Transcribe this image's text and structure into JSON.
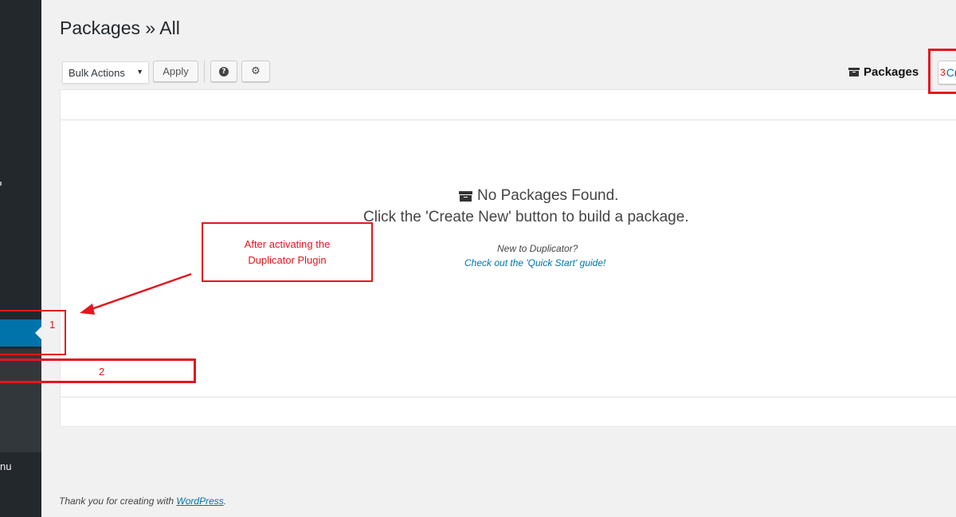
{
  "page": {
    "title": "Packages » All"
  },
  "toolbar": {
    "bulk_actions_label": "Bulk Actions",
    "apply_label": "Apply",
    "help_icon": "question-circle-icon",
    "settings_icon": "gear-icon",
    "packages_tab_label": "Packages",
    "create_new_visible_label": "Cr"
  },
  "empty_state": {
    "title": "No Packages Found.",
    "subtitle": "Click the 'Create New' button to build a package.",
    "new_to_text": "New to Duplicator?",
    "quick_start_link": "Check out the 'Quick Start' guide!"
  },
  "sidebar": {
    "collapse_label_fragment": "nu"
  },
  "footer": {
    "prefix": "Thank you for creating with ",
    "link": "WordPress",
    "suffix": "."
  },
  "annotations": {
    "callout_line1": "After activating the",
    "callout_line2": "Duplicator Plugin",
    "marker_1": "1",
    "marker_2": "2",
    "marker_3": "3"
  },
  "colors": {
    "sidebar_bg": "#23282d",
    "sidebar_submenu_bg": "#32373c",
    "sidebar_current": "#0073aa",
    "link": "#0073aa",
    "annotation_red": "#e3161e",
    "page_bg": "#f1f1f1"
  }
}
